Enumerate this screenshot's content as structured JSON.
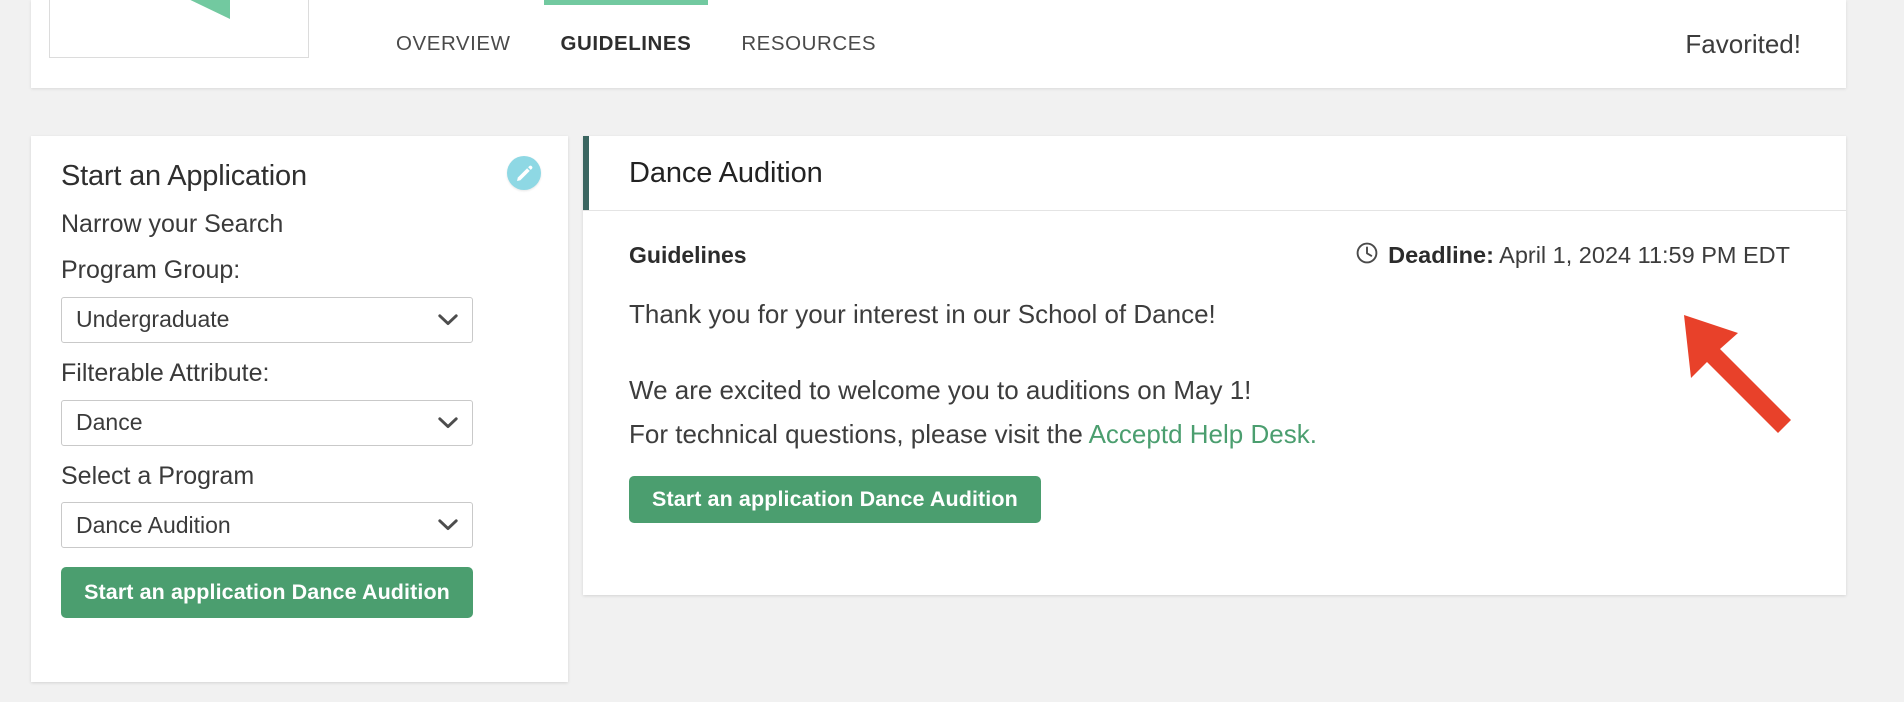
{
  "header": {
    "logo_icon": "speech-bubble-logo",
    "tabs": [
      {
        "label": "OVERVIEW",
        "active": false
      },
      {
        "label": "GUIDELINES",
        "active": true
      },
      {
        "label": "RESOURCES",
        "active": false
      }
    ],
    "favorited_label": "Favorited!"
  },
  "sidebar": {
    "title": "Start an Application",
    "edit_icon": "pencil-icon",
    "subtitle": "Narrow your Search",
    "fields": [
      {
        "label": "Program Group:",
        "value": "Undergraduate"
      },
      {
        "label": "Filterable Attribute:",
        "value": "Dance"
      },
      {
        "label": "Select a Program",
        "value": "Dance Audition"
      }
    ],
    "submit_label": "Start an application Dance Audition"
  },
  "main": {
    "title": "Dance Audition",
    "guidelines_label": "Guidelines",
    "deadline": {
      "icon": "clock-icon",
      "label": "Deadline:",
      "value": "April 1, 2024 11:59 PM EDT"
    },
    "paragraph_1": "Thank you for your interest in our School of Dance!",
    "paragraph_2": "We are excited to welcome you to auditions on May 1!",
    "paragraph_3_prefix": "For technical questions, please visit the ",
    "paragraph_3_link": "Acceptd Help Desk.",
    "submit_label": "Start an application Dance Audition"
  },
  "annotation": {
    "arrow_color": "#e8412a",
    "points_at": "deadline"
  },
  "colors": {
    "brand_green": "#4b9e6f",
    "logo_green": "#72c9a0",
    "accent_teal": "#3a6560",
    "edit_cyan": "#8ed8e4",
    "page_background": "#f1f1f1",
    "annotation_red": "#e8412a"
  }
}
